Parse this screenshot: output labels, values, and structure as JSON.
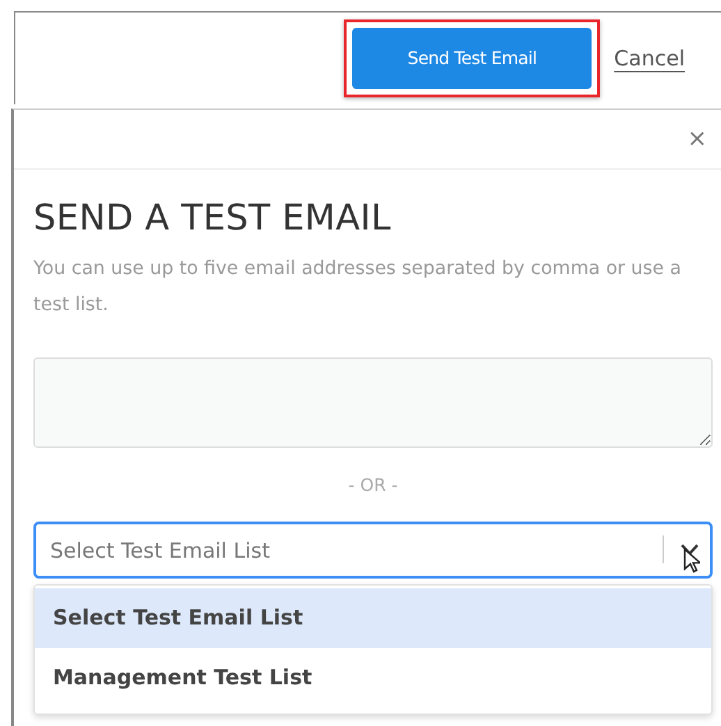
{
  "toolbar": {
    "send_button": {
      "label": "Send Test Email",
      "highlighted": true
    },
    "cancel_link": "Cancel"
  },
  "modal": {
    "close": "×",
    "title": "SEND A TEST EMAIL",
    "description": "You can use up to five email addresses separated by comma or use a test list.",
    "separator": "- OR -",
    "list_select": {
      "placeholder": "Select Test Email List",
      "expanded": true,
      "options": [
        {
          "label": "Select Test Email List",
          "selected": true
        },
        {
          "label": "Management Test List",
          "selected": false
        }
      ]
    }
  }
}
